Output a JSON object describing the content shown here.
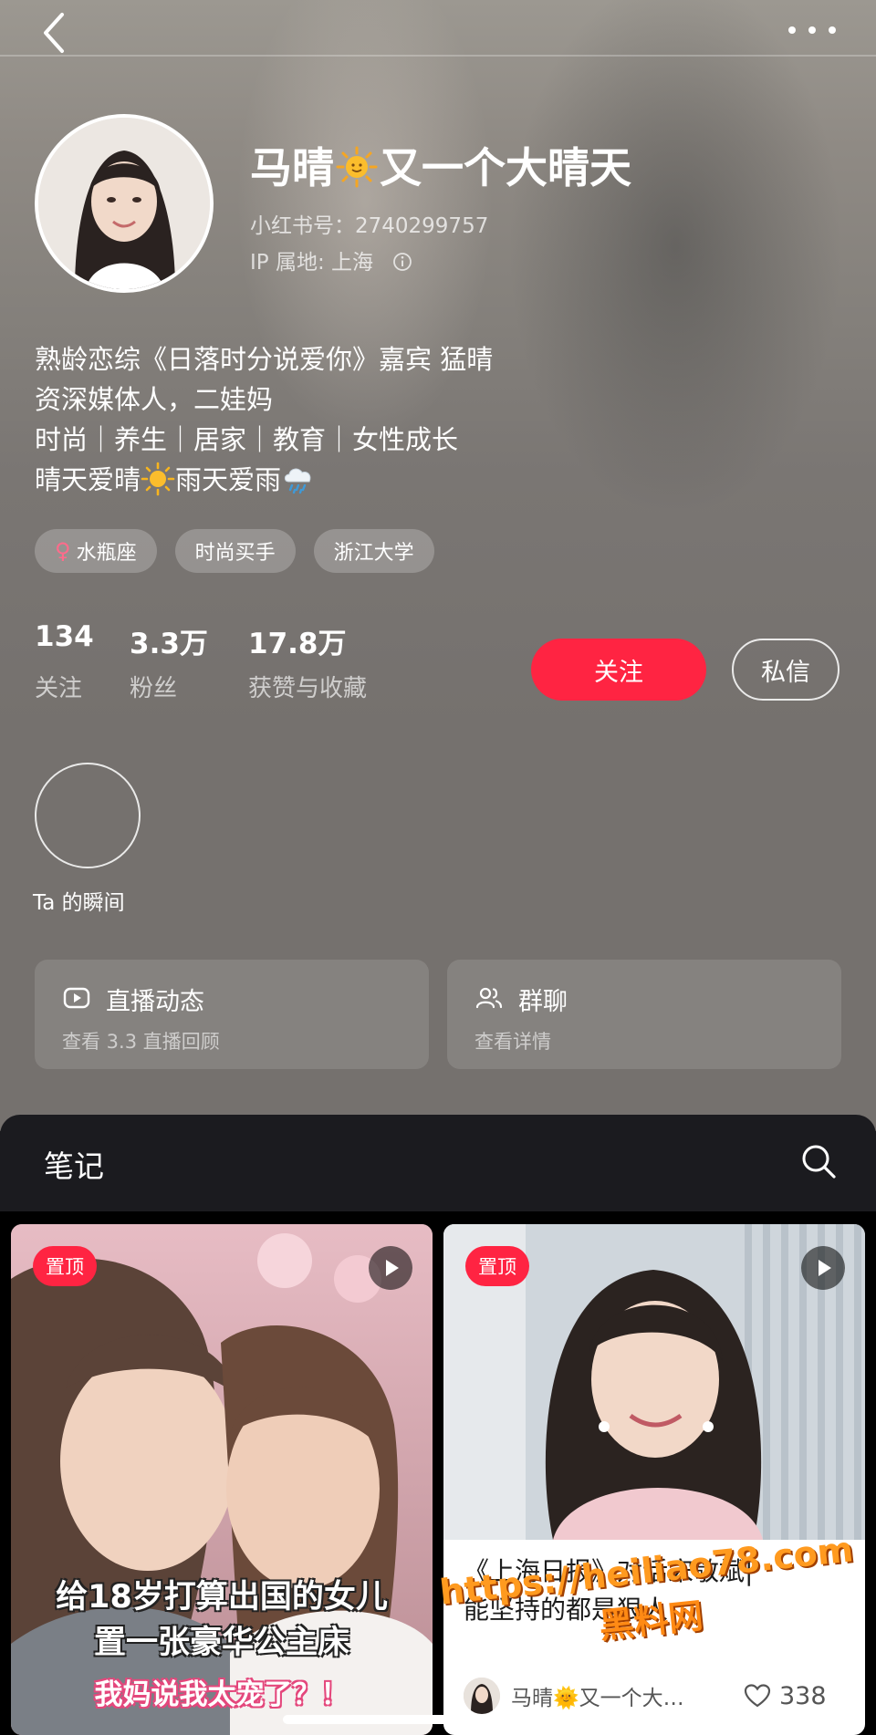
{
  "profile": {
    "name_part1": "马晴",
    "name_part2": "又一个大晴天",
    "redbook_id": "小红书号：2740299757",
    "ip_location": "IP 属地: 上海",
    "bio": [
      "熟龄恋综《日落时分说爱你》嘉宾 猛晴",
      "资深媒体人，二娃妈",
      "时尚｜养生｜居家｜教育｜女性成长"
    ],
    "bio_line4_a": "晴天爱晴",
    "bio_line4_b": "雨天爱雨",
    "tags": [
      "水瓶座",
      "时尚买手",
      "浙江大学"
    ],
    "gender_symbol": "♀"
  },
  "stats": {
    "following": {
      "value": "134",
      "label": "关注"
    },
    "fans": {
      "value": "3.3万",
      "label": "粉丝"
    },
    "likes": {
      "value": "17.8万",
      "label": "获赞与收藏"
    }
  },
  "actions": {
    "follow_label": "关注",
    "message_label": "私信"
  },
  "moments": {
    "label": "Ta 的瞬间"
  },
  "features": {
    "live": {
      "title": "直播动态",
      "subtitle": "查看 3.3 直播回顾"
    },
    "group": {
      "title": "群聊",
      "subtitle": "查看详情"
    }
  },
  "notes": {
    "tab_label": "笔记",
    "cards": [
      {
        "pin_label": "置顶",
        "overlay_line1": "给18岁打算出国的女儿",
        "overlay_line2": "置一张豪华公主床",
        "overlay_line3": "我妈说我太宠了？！"
      },
      {
        "pin_label": "置顶",
        "title_line1": "《上海日报》对话宋敬斌|",
        "title_line2": "能坚持的都是狠人",
        "author": "马晴🌞又一个大…",
        "likes": "338"
      }
    ]
  },
  "watermark": {
    "url": "https://heiliao78.com",
    "name": "黑料网"
  },
  "colors": {
    "accent_red": "#ff2442",
    "header_bg": "#7a7673",
    "panel_bg": "#1b1b1f"
  }
}
